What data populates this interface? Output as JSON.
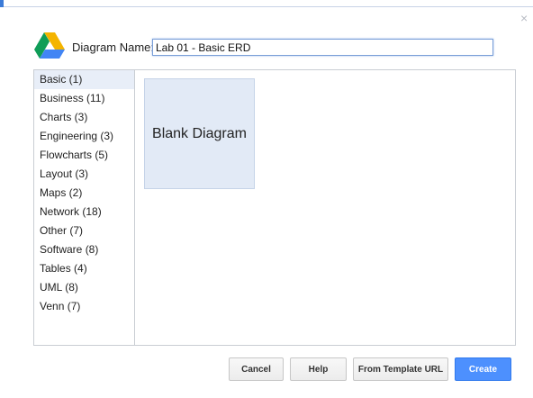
{
  "dialog": {
    "close_symbol": "×",
    "name_label": "Diagram Name:",
    "name_value": "Lab 01 - Basic ERD"
  },
  "categories": [
    {
      "label": "Basic (1)",
      "selected": true
    },
    {
      "label": "Business (11)",
      "selected": false
    },
    {
      "label": "Charts (3)",
      "selected": false
    },
    {
      "label": "Engineering (3)",
      "selected": false
    },
    {
      "label": "Flowcharts (5)",
      "selected": false
    },
    {
      "label": "Layout (3)",
      "selected": false
    },
    {
      "label": "Maps (2)",
      "selected": false
    },
    {
      "label": "Network (18)",
      "selected": false
    },
    {
      "label": "Other (7)",
      "selected": false
    },
    {
      "label": "Software (8)",
      "selected": false
    },
    {
      "label": "Tables (4)",
      "selected": false
    },
    {
      "label": "UML (8)",
      "selected": false
    },
    {
      "label": "Venn (7)",
      "selected": false
    }
  ],
  "templates": [
    {
      "label": "Blank Diagram"
    }
  ],
  "buttons": {
    "cancel": "Cancel",
    "help": "Help",
    "from_template_url": "From Template URL",
    "create": "Create"
  },
  "colors": {
    "accent": "#4d90fe",
    "selected_bg": "#e8eef8",
    "card_bg": "#e2eaf6",
    "drive_green": "#0f9d58",
    "drive_yellow": "#f4b400",
    "drive_blue": "#4285f4"
  },
  "icons": {
    "logo": "google-drive-logo-icon",
    "close": "close-icon"
  }
}
